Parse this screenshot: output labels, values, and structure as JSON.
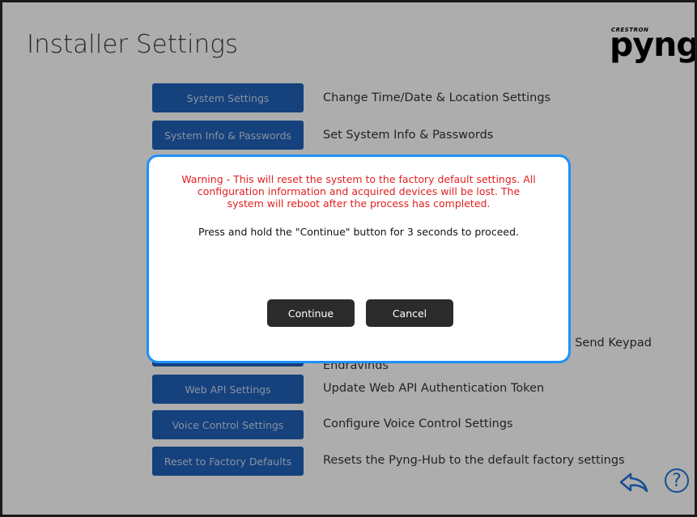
{
  "header": {
    "title": "Installer Settings"
  },
  "logo": {
    "brand": "CRESTRON",
    "wordmark": "pyng"
  },
  "rows": [
    {
      "button": "System Settings",
      "description": "Change Time/Date & Location Settings"
    },
    {
      "button": "System Info & Passwords",
      "description": "Set System Info & Passwords"
    },
    {
      "button": "",
      "description": ", Send Keypad"
    },
    {
      "button": "",
      "description": "Engravings"
    },
    {
      "button": "Web API Settings",
      "description": "Update Web API Authentication Token"
    },
    {
      "button": "Voice Control Settings",
      "description": "Configure Voice Control Settings"
    },
    {
      "button": "Reset to Factory Defaults",
      "description": "Resets the Pyng-Hub to the default factory settings"
    }
  ],
  "modal": {
    "warning": "Warning - This will reset the system to the factory default settings. All configuration information and acquired devices will be lost. The system will reboot after the process has completed.",
    "instruction": "Press and hold the \"Continue\" button for 3 seconds to proceed.",
    "continue_label": "Continue",
    "cancel_label": "Cancel"
  },
  "footer": {
    "back_icon": "back-arrow-icon",
    "help_icon": "help-icon",
    "help_glyph": "?"
  },
  "colors": {
    "primary_button": "#1f60b8",
    "modal_border": "#1e90ff",
    "warning_text": "#e02020",
    "dialog_button": "#2b2b2b"
  }
}
